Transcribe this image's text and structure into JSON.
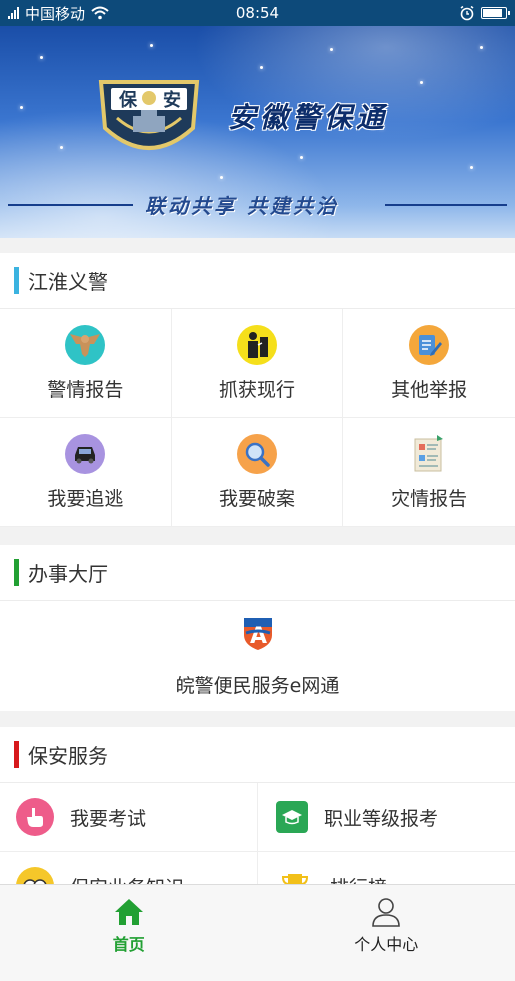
{
  "status_bar": {
    "carrier": "中国移动",
    "time": "08:54"
  },
  "banner": {
    "badge_text": "保安",
    "title": "安徽警保通",
    "slogan": "联动共享  共建共治"
  },
  "sections": {
    "jianghuai": {
      "title": "江淮义警",
      "accent": "#3bb3e0",
      "items": [
        {
          "label": "警情报告",
          "icon": "eagle-icon"
        },
        {
          "label": "抓获现行",
          "icon": "arrest-icon"
        },
        {
          "label": "其他举报",
          "icon": "report-edit-icon"
        },
        {
          "label": "我要追逃",
          "icon": "car-icon"
        },
        {
          "label": "我要破案",
          "icon": "magnifier-icon"
        },
        {
          "label": "灾情报告",
          "icon": "document-icon"
        }
      ]
    },
    "office": {
      "title": "办事大厅",
      "accent": "#22a033",
      "item_label": "皖警便民服务e网通",
      "item_icon": "ewangtong-logo-icon"
    },
    "security": {
      "title": "保安服务",
      "accent": "#d7191c",
      "items": [
        {
          "label": "我要考试",
          "icon": "hand-point-icon"
        },
        {
          "label": "职业等级报考",
          "icon": "graduation-cap-icon"
        },
        {
          "label": "保安业务知识",
          "icon": "owl-icon"
        },
        {
          "label": "排行榜",
          "icon": "trophy-icon"
        }
      ]
    }
  },
  "bottom_nav": {
    "home": "首页",
    "profile": "个人中心"
  },
  "colors": {
    "active_nav": "#22a033"
  }
}
